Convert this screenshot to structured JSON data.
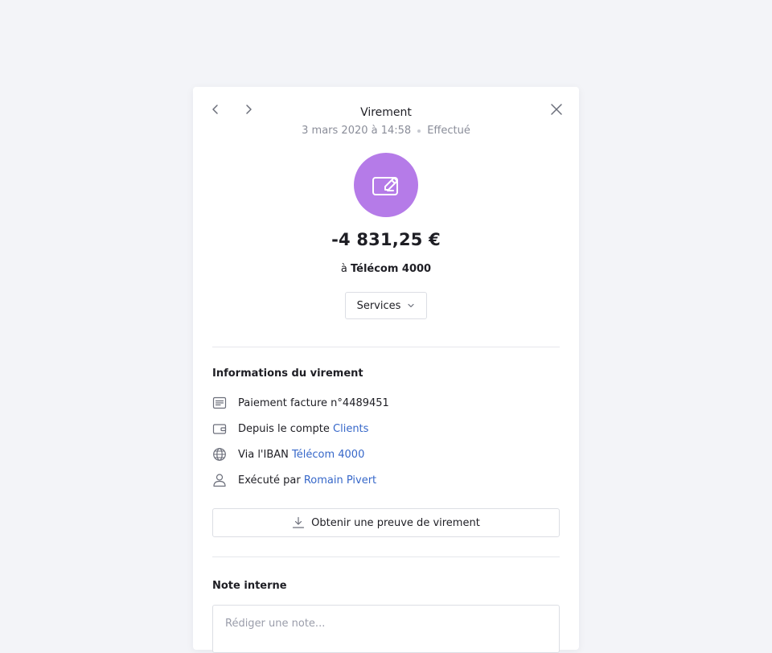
{
  "header": {
    "title": "Virement",
    "date": "3 mars 2020 à 14:58",
    "status": "Effectué"
  },
  "transaction": {
    "amount": "-4 831,25 €",
    "recipient_prefix": "à",
    "recipient_name": "Télécom 4000",
    "avatar_color": "#b57be8",
    "avatar_icon": "cheque-icon"
  },
  "category": {
    "selected": "Services"
  },
  "info": {
    "title": "Informations du virement",
    "reference": "Paiement facture n°4489451",
    "account_prefix": "Depuis le compte",
    "account_link": "Clients",
    "iban_prefix": "Via l'IBAN",
    "iban_link": "Télécom 4000",
    "executed_prefix": "Exécuté par",
    "executed_link": "Romain Pivert"
  },
  "proof_button": {
    "label": "Obtenir une preuve de virement"
  },
  "note": {
    "title": "Note interne",
    "placeholder": "Rédiger une note...",
    "value": ""
  },
  "colors": {
    "background": "#f3f4f8",
    "link": "#3667c9",
    "muted": "#8a8d99"
  }
}
